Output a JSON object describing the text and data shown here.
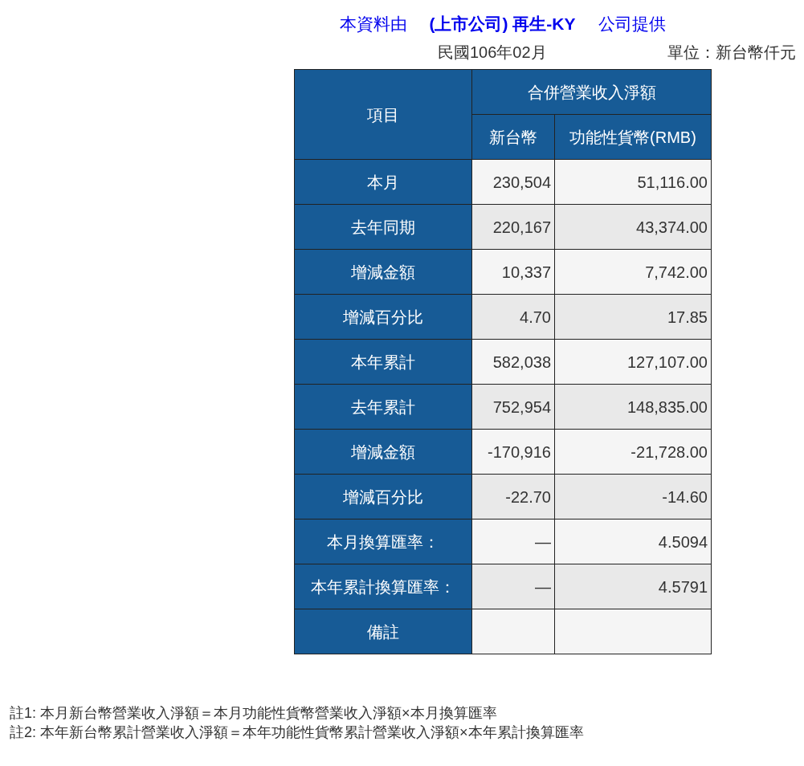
{
  "title": {
    "prefix": "本資料由",
    "company": "(上市公司) 再生-KY",
    "suffix": "公司提供"
  },
  "period": "民國106年02月",
  "unit": "單位：新台幣仟元",
  "table": {
    "item_header": "項目",
    "group_header": "合併營業收入淨額",
    "columns": [
      "新台幣",
      "功能性貨幣(RMB)"
    ],
    "rows": [
      {
        "label": "本月",
        "ntd": "230,504",
        "rmb": "51,116.00"
      },
      {
        "label": "去年同期",
        "ntd": "220,167",
        "rmb": "43,374.00"
      },
      {
        "label": "增減金額",
        "ntd": "10,337",
        "rmb": "7,742.00"
      },
      {
        "label": "增減百分比",
        "ntd": "4.70",
        "rmb": "17.85"
      },
      {
        "label": "本年累計",
        "ntd": "582,038",
        "rmb": "127,107.00"
      },
      {
        "label": "去年累計",
        "ntd": "752,954",
        "rmb": "148,835.00"
      },
      {
        "label": "增減金額",
        "ntd": "-170,916",
        "rmb": "-21,728.00"
      },
      {
        "label": "增減百分比",
        "ntd": "-22.70",
        "rmb": "-14.60"
      },
      {
        "label": "本月換算匯率：",
        "ntd": "—",
        "rmb": "4.5094"
      },
      {
        "label": "本年累計換算匯率：",
        "ntd": "—",
        "rmb": "4.5791"
      },
      {
        "label": "備註"
      }
    ]
  },
  "notes": [
    "註1: 本月新台幣營業收入淨額＝本月功能性貨幣營業收入淨額×本月換算匯率",
    "註2: 本年新台幣累計營業收入淨額＝本年功能性貨幣累計營業收入淨額×本年累計換算匯率"
  ]
}
